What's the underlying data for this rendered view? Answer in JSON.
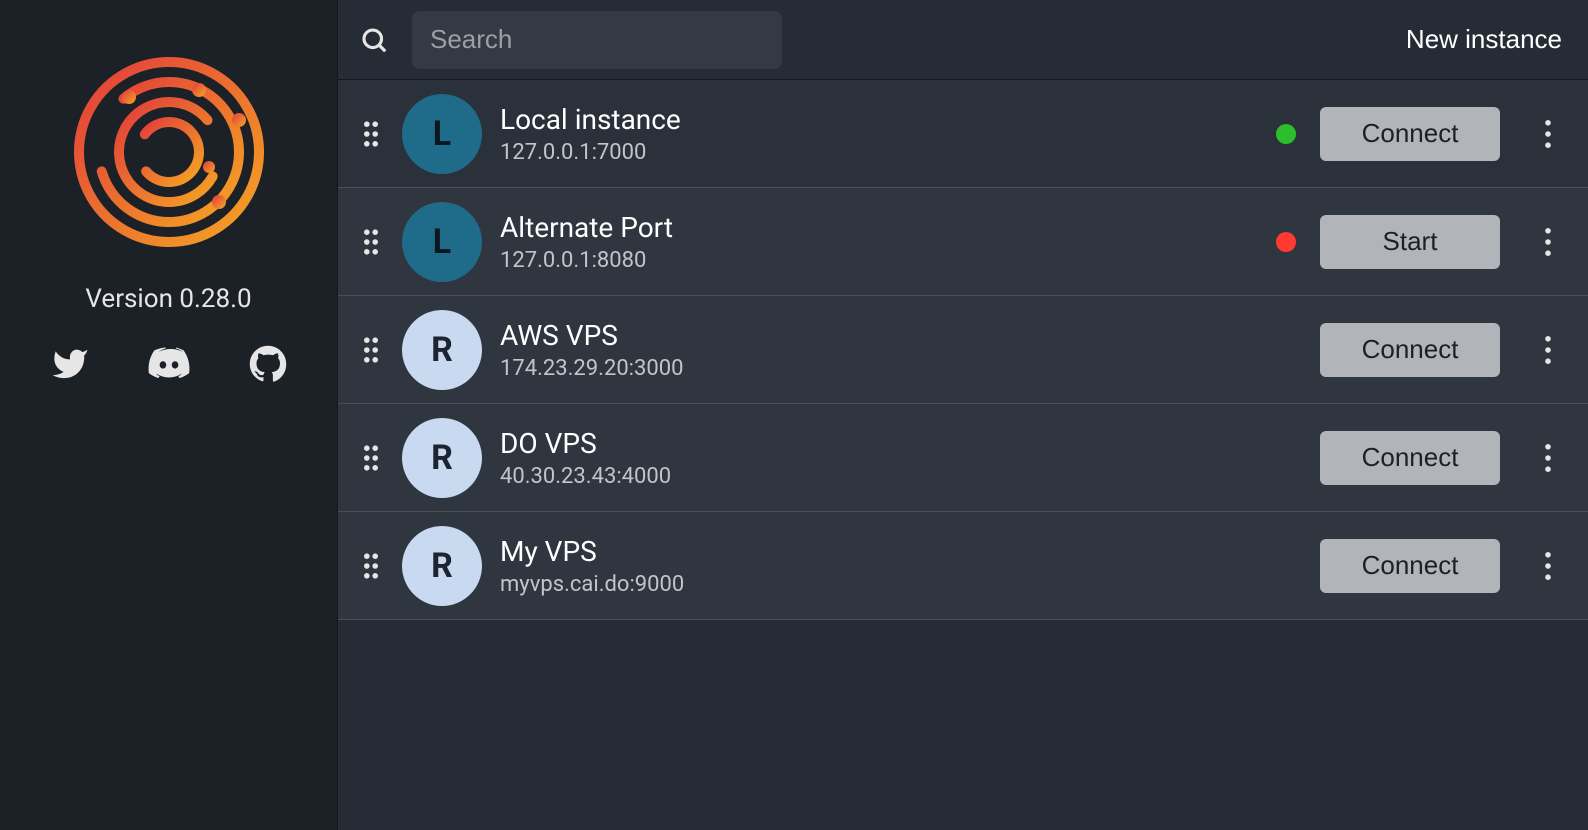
{
  "sidebar": {
    "version_label": "Version 0.28.0",
    "social": {
      "twitter": "twitter-icon",
      "discord": "discord-icon",
      "github": "github-icon"
    }
  },
  "header": {
    "search_placeholder": "Search",
    "new_instance_label": "New instance"
  },
  "instances": [
    {
      "avatar_letter": "L",
      "avatar_kind": "local",
      "name": "Local instance",
      "address": "127.0.0.1:7000",
      "status": "green",
      "action": "Connect",
      "row_bg": "dark"
    },
    {
      "avatar_letter": "L",
      "avatar_kind": "local",
      "name": "Alternate Port",
      "address": "127.0.0.1:8080",
      "status": "red",
      "action": "Start",
      "row_bg": "light"
    },
    {
      "avatar_letter": "R",
      "avatar_kind": "remote",
      "name": "AWS VPS",
      "address": "174.23.29.20:3000",
      "status": null,
      "action": "Connect",
      "row_bg": "light"
    },
    {
      "avatar_letter": "R",
      "avatar_kind": "remote",
      "name": "DO VPS",
      "address": "40.30.23.43:4000",
      "status": null,
      "action": "Connect",
      "row_bg": "light"
    },
    {
      "avatar_letter": "R",
      "avatar_kind": "remote",
      "name": "My VPS",
      "address": "myvps.cai.do:9000",
      "status": null,
      "action": "Connect",
      "row_bg": "light"
    }
  ]
}
